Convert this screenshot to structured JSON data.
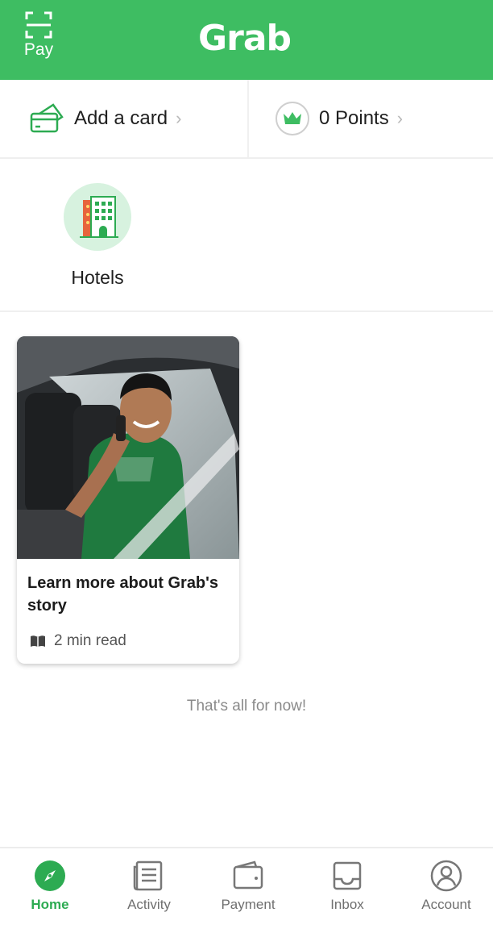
{
  "header": {
    "pay_label": "Pay",
    "logo_text": "Grab",
    "brand_color": "#3ebd62"
  },
  "quick_actions": {
    "card": {
      "label": "Add a card",
      "icon": "credit-card-icon"
    },
    "points": {
      "label": "0 Points",
      "icon": "crown-icon"
    }
  },
  "services": [
    {
      "label": "Hotels",
      "icon": "hotel-icon"
    }
  ],
  "story": {
    "title": "Learn more about Grab's story",
    "read_time": "2 min read",
    "icon": "book-icon"
  },
  "end_note": "That's all for now!",
  "tabs": [
    {
      "label": "Home",
      "icon": "compass-icon",
      "active": true
    },
    {
      "label": "Activity",
      "icon": "receipt-icon",
      "active": false
    },
    {
      "label": "Payment",
      "icon": "wallet-icon",
      "active": false
    },
    {
      "label": "Inbox",
      "icon": "inbox-icon",
      "active": false
    },
    {
      "label": "Account",
      "icon": "user-icon",
      "active": false
    }
  ],
  "colors": {
    "accent": "#2dab52",
    "muted": "#6f6f6f"
  }
}
